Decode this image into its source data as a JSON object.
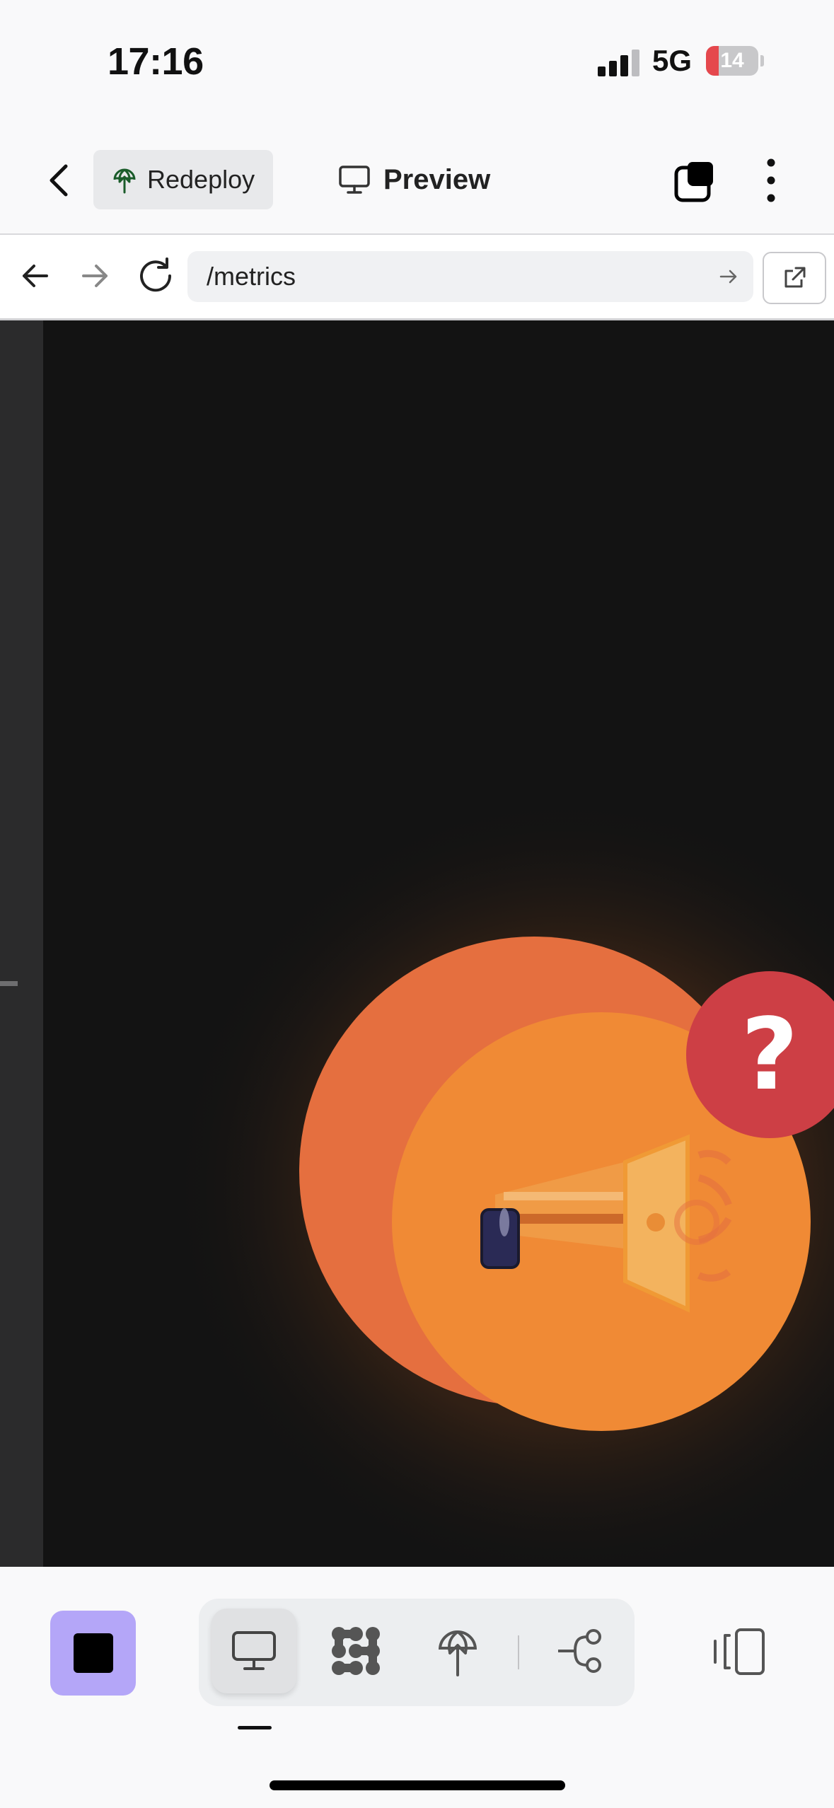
{
  "status_bar": {
    "time": "17:16",
    "network": "5G",
    "battery": "14"
  },
  "toolbar": {
    "back_icon": "chevron-left-icon",
    "redeploy_label": "Redeploy",
    "redeploy_icon": "globe-upload-icon",
    "preview_label": "Preview",
    "preview_icon": "monitor-icon",
    "layers_icon": "stacked-squares-icon",
    "more_icon": "vertical-ellipsis-icon"
  },
  "browser": {
    "url": "/metrics",
    "back_icon": "arrow-left-icon",
    "forward_icon": "arrow-right-icon",
    "reload_icon": "reload-icon",
    "go_icon": "arrow-right-icon",
    "open_external_icon": "external-link-icon"
  },
  "preview": {
    "background_color": "#131313",
    "illustration": "megaphone-illustration",
    "help_badge": "?",
    "help_badge_color": "#cd3f45",
    "accent_orange": "#f08a35"
  },
  "bottom_bar": {
    "stop_icon": "stop-icon",
    "stop_color": "#b4a6f8",
    "tabs": [
      {
        "icon": "monitor-icon",
        "active": true
      },
      {
        "icon": "agents-icon",
        "active": false
      },
      {
        "icon": "globe-upload-icon",
        "active": false
      },
      {
        "icon": "branch-icon",
        "active": false
      }
    ],
    "panel_icon": "panel-toggle-icon"
  }
}
